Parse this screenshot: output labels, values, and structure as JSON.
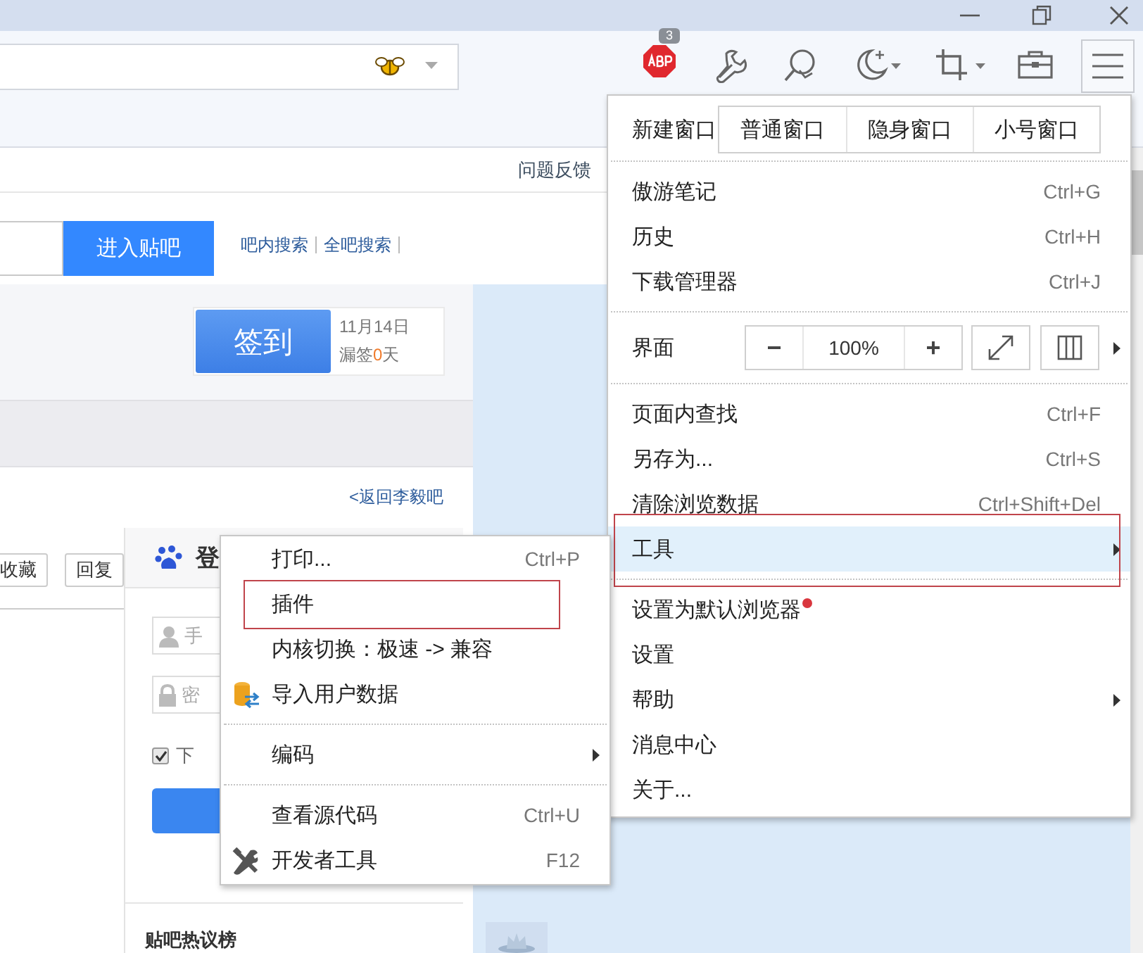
{
  "toolbar": {
    "badge": "3"
  },
  "page": {
    "top_link": "问题反馈",
    "search": {
      "button": "进入贴吧",
      "links": [
        "吧内搜索",
        "全吧搜索"
      ]
    },
    "sign_in": {
      "button": "签到",
      "date": "11月14日",
      "missed_before": "漏签",
      "missed_count": "0",
      "missed_after": "天"
    },
    "back_link": "<返回李毅吧",
    "post_buttons": [
      "收藏",
      "回复"
    ],
    "login": {
      "title": "登",
      "account_placeholder": "手",
      "password_placeholder": "密",
      "remember": {
        "label": "下",
        "checked": true
      }
    },
    "hot_title": "贴吧热议榜"
  },
  "main_menu": [
    {
      "kind": "windows",
      "label": "新建窗口",
      "buttons": [
        "普通窗口",
        "隐身窗口",
        "小号窗口"
      ]
    },
    {
      "kind": "separator"
    },
    {
      "kind": "item",
      "label": "傲游笔记",
      "shortcut": "Ctrl+G",
      "submenu": false,
      "hovered": false,
      "outlined": false,
      "dot": false
    },
    {
      "kind": "item",
      "label": "历史",
      "shortcut": "Ctrl+H",
      "submenu": false,
      "hovered": false,
      "outlined": false,
      "dot": false
    },
    {
      "kind": "item",
      "label": "下载管理器",
      "shortcut": "Ctrl+J",
      "submenu": false,
      "hovered": false,
      "outlined": false,
      "dot": false
    },
    {
      "kind": "separator"
    },
    {
      "kind": "zoom",
      "label": "界面",
      "minus": "−",
      "zoom": "100%",
      "plus": "+",
      "submenu": true
    },
    {
      "kind": "separator"
    },
    {
      "kind": "item",
      "label": "页面内查找",
      "shortcut": "Ctrl+F",
      "submenu": false,
      "hovered": false,
      "outlined": false,
      "dot": false
    },
    {
      "kind": "item",
      "label": "另存为...",
      "shortcut": "Ctrl+S",
      "submenu": false,
      "hovered": false,
      "outlined": false,
      "dot": false
    },
    {
      "kind": "item",
      "label": "清除浏览数据",
      "shortcut": "Ctrl+Shift+Del",
      "submenu": false,
      "hovered": false,
      "outlined": false,
      "dot": false
    },
    {
      "kind": "item",
      "label": "工具",
      "submenu": true,
      "hovered": true,
      "outlined": true,
      "dot": false
    },
    {
      "kind": "separator"
    },
    {
      "kind": "item",
      "label": "设置为默认浏览器",
      "submenu": false,
      "hovered": false,
      "outlined": false,
      "dot": true
    },
    {
      "kind": "item",
      "label": "设置",
      "submenu": false,
      "hovered": false,
      "outlined": false,
      "dot": false
    },
    {
      "kind": "item",
      "label": "帮助",
      "submenu": true,
      "hovered": false,
      "outlined": false,
      "dot": false
    },
    {
      "kind": "item",
      "label": "消息中心",
      "submenu": false,
      "hovered": false,
      "outlined": false,
      "dot": false
    },
    {
      "kind": "item",
      "label": "关于...",
      "submenu": false,
      "hovered": false,
      "outlined": false,
      "dot": false
    }
  ],
  "sub_menu": [
    {
      "kind": "item",
      "label": "打印...",
      "shortcut": "Ctrl+P",
      "submenu": false,
      "hovered": false,
      "outlined": false,
      "dot": false
    },
    {
      "kind": "item",
      "label": "插件",
      "submenu": false,
      "hovered": false,
      "outlined": true,
      "dot": false
    },
    {
      "kind": "item",
      "label": "内核切换：极速 -> 兼容",
      "submenu": false,
      "hovered": false,
      "outlined": false,
      "dot": false
    },
    {
      "kind": "import_item",
      "label": "导入用户数据",
      "submenu": false,
      "hovered": false,
      "outlined": false,
      "dot": false
    },
    {
      "kind": "separator"
    },
    {
      "kind": "item",
      "label": "编码",
      "submenu": true,
      "hovered": false,
      "outlined": false,
      "dot": false
    },
    {
      "kind": "separator"
    },
    {
      "kind": "item",
      "label": "查看源代码",
      "shortcut": "Ctrl+U",
      "submenu": false,
      "hovered": false,
      "outlined": false,
      "dot": false
    },
    {
      "kind": "tools_item",
      "label": "开发者工具",
      "shortcut": "F12",
      "submenu": false,
      "hovered": false,
      "outlined": false,
      "dot": false
    }
  ]
}
